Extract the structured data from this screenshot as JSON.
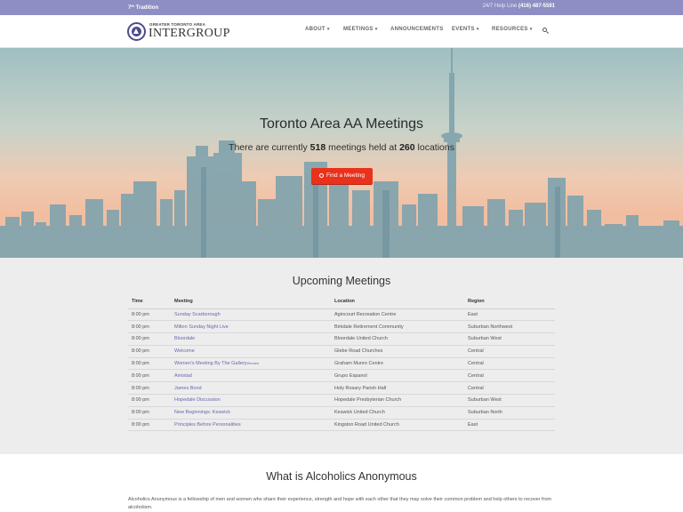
{
  "topbar": {
    "tradition_prefix": "7",
    "tradition_sup": "th",
    "tradition_suffix": " Tradition",
    "helpline_label": "24/7 Help Line",
    "helpline_number": "(416) 487-5591"
  },
  "logo": {
    "small": "GREATER TORONTO AREA",
    "big": "INTERGROUP"
  },
  "nav": {
    "about": "ABOUT",
    "meetings": "MEETINGS",
    "announcements": "ANNOUNCEMENTS",
    "events": "EVENTS",
    "resources": "RESOURCES"
  },
  "hero": {
    "title": "Toronto Area AA Meetings",
    "sub_pre": "There are currently ",
    "meetings_count": "518",
    "sub_mid": " meetings held at ",
    "locations_count": "260",
    "sub_post": " locations",
    "button": "Find a Meeting"
  },
  "upcoming": {
    "title": "Upcoming Meetings",
    "headers": {
      "time": "Time",
      "meeting": "Meeting",
      "location": "Location",
      "region": "Region"
    },
    "rows": [
      {
        "time": "8:00 pm",
        "meeting": "Sunday Scarborough",
        "tag": "",
        "location": "Agincourt Recreation Centre",
        "region": "East"
      },
      {
        "time": "8:00 pm",
        "meeting": "Milton Sunday Night Live",
        "tag": "",
        "location": "Birkdale Retirement Community",
        "region": "Suburban Northwest"
      },
      {
        "time": "8:00 pm",
        "meeting": "Bloordale",
        "tag": "",
        "location": "Bloordale United Church",
        "region": "Suburban West"
      },
      {
        "time": "8:00 pm",
        "meeting": "Welcome",
        "tag": "",
        "location": "Glebe Road Churches",
        "region": "Central"
      },
      {
        "time": "8:00 pm",
        "meeting": "Women's Meeting By The Gallery",
        "tag": "Women",
        "location": "Graham Munro Centre",
        "region": "Central"
      },
      {
        "time": "8:00 pm",
        "meeting": "Amistad",
        "tag": "",
        "location": "Grupo Espanol",
        "region": "Central"
      },
      {
        "time": "8:00 pm",
        "meeting": "James Bond",
        "tag": "",
        "location": "Holy Rosary Parish Hall",
        "region": "Central"
      },
      {
        "time": "8:00 pm",
        "meeting": "Hopedale Discussion",
        "tag": "",
        "location": "Hopedale Presbyterian Church",
        "region": "Suburban West"
      },
      {
        "time": "8:00 pm",
        "meeting": "New Beginnings: Keswick",
        "tag": "",
        "location": "Keswick United Church",
        "region": "Suburban North"
      },
      {
        "time": "8:00 pm",
        "meeting": "Principles Before Personalities",
        "tag": "",
        "location": "Kingston Road United Church",
        "region": "East"
      }
    ]
  },
  "whatis": {
    "title": "What is Alcoholics Anonymous",
    "text": "Alcoholics Anonymous is a fellowship of men and women who share their experience, strength and hope with each other that they may solve their common problem and help others to recover from alcoholism."
  },
  "colors": {
    "topbar": "#8e8ec4",
    "brand": "#4c4c8e",
    "link": "#6767ad",
    "button": "#e8321c",
    "section_bg": "#ededed"
  },
  "icons": {
    "search": "search-icon",
    "logo": "aa-circle-triangle-logo",
    "caret": "caret-down-icon"
  }
}
